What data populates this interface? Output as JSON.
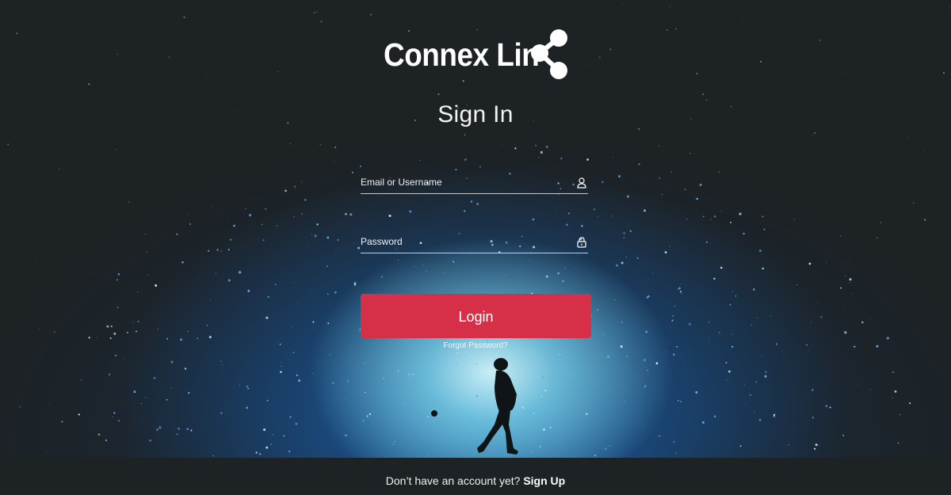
{
  "brand": {
    "name": "Connex Lin",
    "logo_icon": "connection-nodes-icon"
  },
  "page_title": "Sign In",
  "form": {
    "email": {
      "label": "Email or Username",
      "icon": "user-icon"
    },
    "password": {
      "label": "Password",
      "icon": "lock-icon"
    },
    "login_label": "Login",
    "forgot_label": "Forgot Password?"
  },
  "footer": {
    "prompt": "Don’t have an account yet?",
    "signup_label": "Sign Up"
  },
  "colors": {
    "background": "#1d2225",
    "login_button": "#d63048",
    "glow": "#82d7eb"
  }
}
